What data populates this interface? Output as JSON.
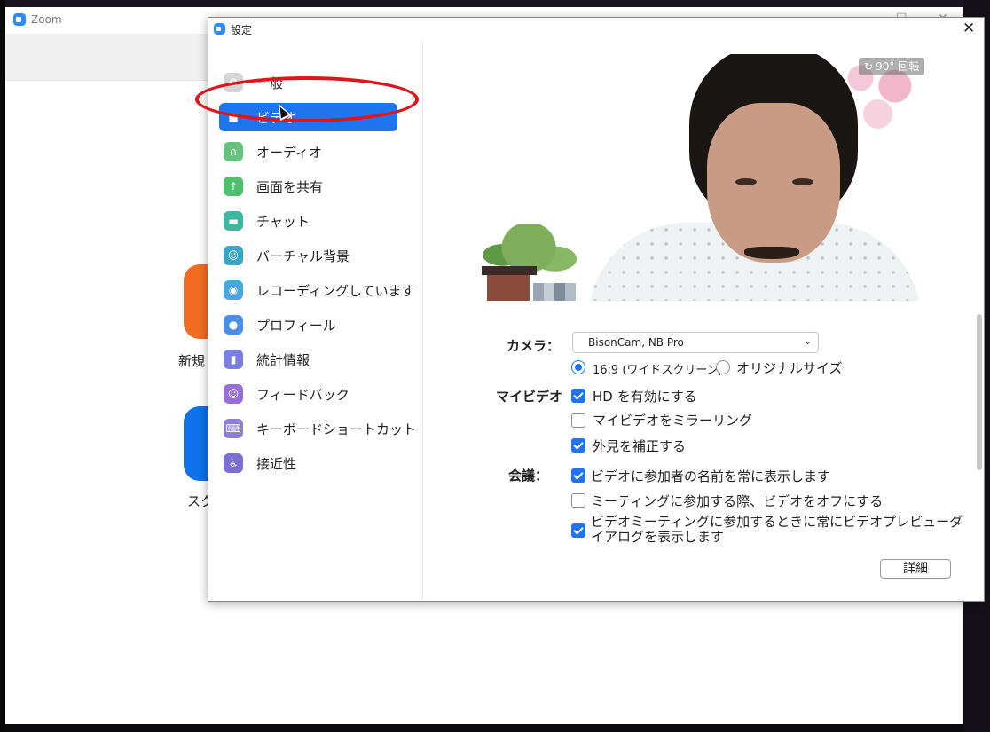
{
  "background_window": {
    "title": "Zoom",
    "tiles": [
      {
        "label": "新規",
        "color": "#f26d21"
      },
      {
        "label": "スク",
        "color": "#0e72ed"
      }
    ]
  },
  "dialog": {
    "title": "設定",
    "close_glyph": "✕"
  },
  "sidebar": {
    "items": [
      {
        "label": "一般",
        "icon": "gear-icon",
        "color": "#d5d5d5",
        "glyph": "⚙"
      },
      {
        "label": "ビデオ",
        "icon": "video-camera-icon",
        "color": "#1f75f0",
        "glyph": "■",
        "active": true
      },
      {
        "label": "オーディオ",
        "icon": "headphones-icon",
        "color": "#67c27d",
        "glyph": "∩"
      },
      {
        "label": "画面を共有",
        "icon": "share-screen-icon",
        "color": "#4fbf6e",
        "glyph": "↑"
      },
      {
        "label": "チャット",
        "icon": "chat-icon",
        "color": "#3fb7a0",
        "glyph": "▬"
      },
      {
        "label": "バーチャル背景",
        "icon": "virtual-background-icon",
        "color": "#3aa6c7",
        "glyph": "☺"
      },
      {
        "label": "レコーディングしています",
        "icon": "recording-icon",
        "color": "#4aa6e0",
        "glyph": "◉"
      },
      {
        "label": "プロフィール",
        "icon": "profile-icon",
        "color": "#4b8ee6",
        "glyph": "●"
      },
      {
        "label": "統計情報",
        "icon": "statistics-icon",
        "color": "#7a7fe0",
        "glyph": "▮"
      },
      {
        "label": "フィードバック",
        "icon": "feedback-icon",
        "color": "#9a6ed8",
        "glyph": "☺"
      },
      {
        "label": "キーボードショートカット",
        "icon": "keyboard-icon",
        "color": "#8e7ed8",
        "glyph": "⌨"
      },
      {
        "label": "接近性",
        "icon": "accessibility-icon",
        "color": "#7c6ed2",
        "glyph": "♿"
      }
    ]
  },
  "preview": {
    "rotate_label": "90° 回転",
    "rotate_glyph": "↻"
  },
  "video_settings": {
    "camera_label": "カメラ：",
    "camera_value": "BisonCam, NB Pro",
    "camera_chevron": "⌄",
    "aspect_options": [
      {
        "label": "16:9 (ワイドスクリーン)",
        "selected": true
      },
      {
        "label": "オリジナルサイズ",
        "selected": false
      }
    ],
    "my_video_label": "マイビデオ",
    "my_video_options": [
      {
        "label": "HD を有効にする",
        "checked": true
      },
      {
        "label": "マイビデオをミラーリング",
        "checked": false
      },
      {
        "label": "外見を補正する",
        "checked": true
      }
    ],
    "meeting_label": "会議：",
    "meeting_options": [
      {
        "label": "ビデオに参加者の名前を常に表示します",
        "checked": true
      },
      {
        "label": "ミーティングに参加する際、ビデオをオフにする",
        "checked": false
      },
      {
        "label": "ビデオミーティングに参加するときに常にビデオプレビューダイアログを表示します",
        "checked": true
      }
    ],
    "detail_button": "詳細"
  },
  "colors": {
    "accent": "#1f75f0",
    "annotation": "#e0141c"
  }
}
